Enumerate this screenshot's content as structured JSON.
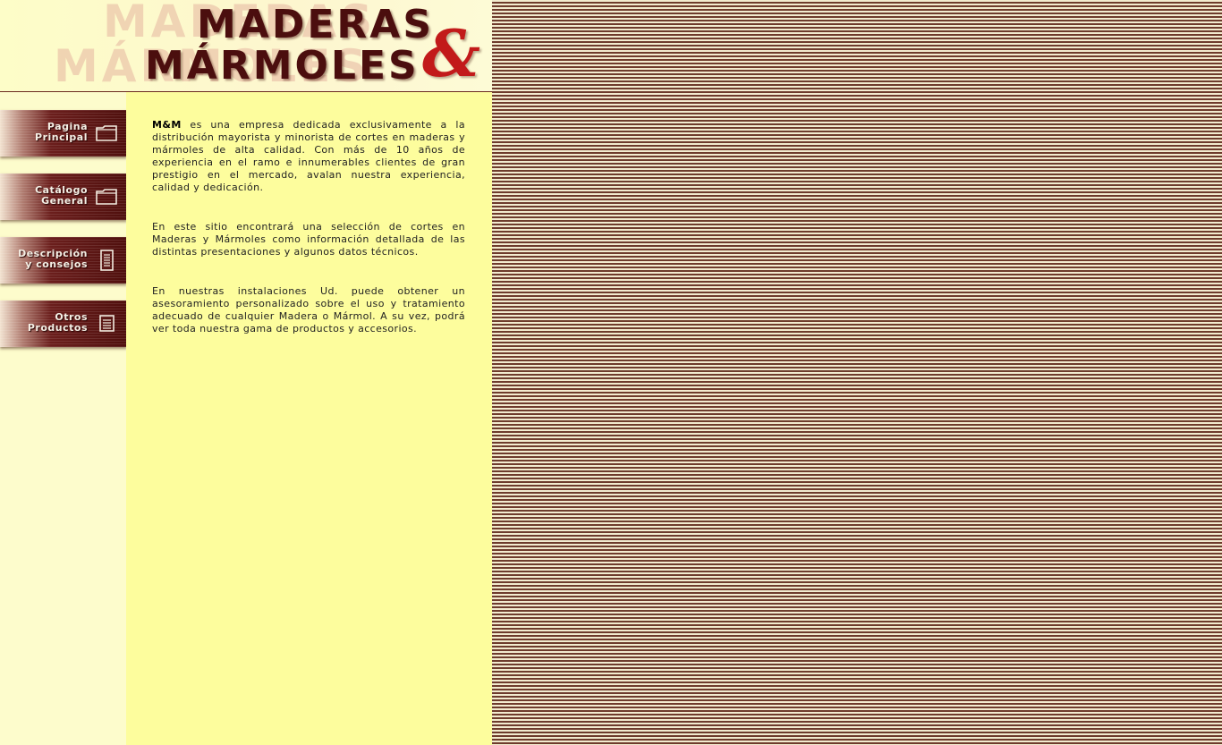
{
  "brand": {
    "line1": "MADERAS",
    "line2": "MÁRMOLES",
    "ampersand": "&",
    "ghost1": "MADERAS",
    "ghost2": "MÁRMOLES"
  },
  "nav": [
    {
      "label": "Pagina\nPrincipal",
      "icon": "folder-icon"
    },
    {
      "label": "Catálogo\nGeneral",
      "icon": "folder-icon"
    },
    {
      "label": "Descripción\ny consejos",
      "icon": "document-icon"
    },
    {
      "label": "Otros\nProductos",
      "icon": "list-icon"
    }
  ],
  "content": {
    "p1_bold": "M&M",
    "p1_rest": " es una empresa dedicada exclusivamente a la distribución mayorista y minorista de cortes en maderas y mármoles de alta calidad. Con más de 10 años de experiencia en el ramo e innumerables clientes de gran prestigio en el mercado, avalan nuestra experiencia, calidad y dedicación.",
    "p2": "En este sitio encontrará una selección de cortes en Maderas y Mármoles como información detallada de las distintas presentaciones y algunos datos técnicos.",
    "p3": "En nuestras instalaciones Ud. puede obtener un asesoramiento personalizado sobre el uso y tratamiento adecuado de cualquier Madera o Mármol. A su vez, podrá ver toda nuestra gama de productos y accesorios."
  },
  "colors": {
    "accent_maroon": "#4b0e0e",
    "ampersand_red": "#c21a1a",
    "content_bg": "#fdfd9d",
    "sidebar_bg": "#fdfccc"
  }
}
